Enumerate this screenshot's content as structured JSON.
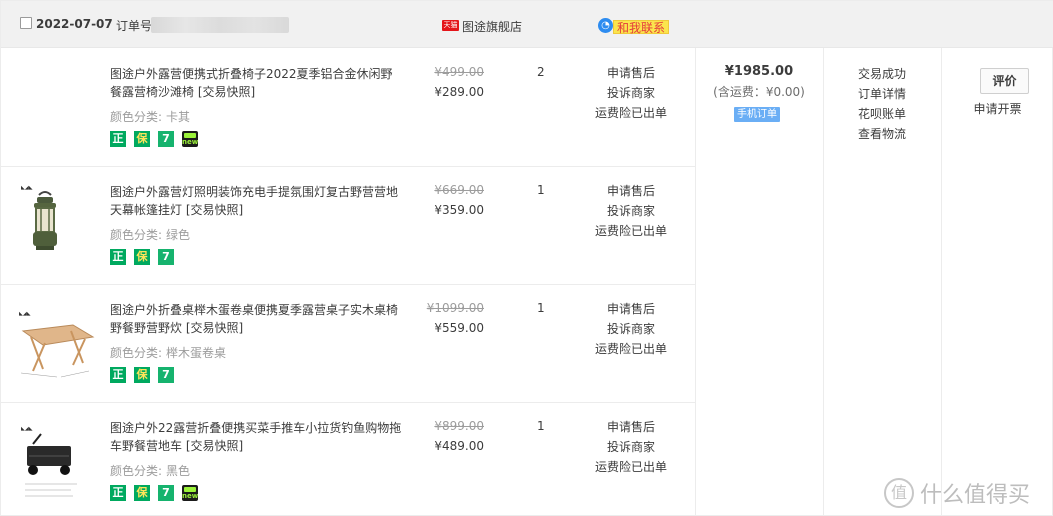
{
  "header": {
    "date": "2022-07-07",
    "order_no_label": "订单号",
    "shop_badge": "天猫",
    "shop_name": "图途旗舰店",
    "contact_label": "和我联系"
  },
  "items": [
    {
      "title": "图途户外露营便携式折叠椅子2022夏季铝合金休闲野餐露营椅沙滩椅 [交易快照]",
      "attr_label": "颜色分类:",
      "attr_value": "卡其",
      "orig_price": "¥499.00",
      "price": "¥289.00",
      "qty": "2",
      "ops": [
        "申请售后",
        "投诉商家",
        "运费险已出单"
      ],
      "icons": [
        "正",
        "保",
        "7",
        "new"
      ],
      "image": "none"
    },
    {
      "title": "图途户外露营灯照明装饰充电手提氛围灯复古野营营地天幕帐篷挂灯 [交易快照]",
      "attr_label": "颜色分类:",
      "attr_value": "绿色",
      "orig_price": "¥669.00",
      "price": "¥359.00",
      "qty": "1",
      "ops": [
        "申请售后",
        "投诉商家",
        "运费险已出单"
      ],
      "icons": [
        "正",
        "保",
        "7"
      ],
      "image": "lantern"
    },
    {
      "title": "图途户外折叠桌榉木蛋卷桌便携夏季露营桌子实木桌椅野餐野营野炊 [交易快照]",
      "attr_label": "颜色分类:",
      "attr_value": "榉木蛋卷桌",
      "orig_price": "¥1099.00",
      "price": "¥559.00",
      "qty": "1",
      "ops": [
        "申请售后",
        "投诉商家",
        "运费险已出单"
      ],
      "icons": [
        "正",
        "保",
        "7"
      ],
      "image": "table"
    },
    {
      "title": "图途户外22露营折叠便携买菜手推车小拉货钓鱼购物拖车野餐营地车 [交易快照]",
      "attr_label": "颜色分类:",
      "attr_value": "黑色",
      "orig_price": "¥899.00",
      "price": "¥489.00",
      "qty": "1",
      "ops": [
        "申请售后",
        "投诉商家",
        "运费险已出单"
      ],
      "icons": [
        "正",
        "保",
        "7",
        "new"
      ],
      "image": "cart"
    }
  ],
  "summary": {
    "total": "¥1985.00",
    "shipping": "(含运费：¥0.00)",
    "mobile_tag": "手机订单"
  },
  "status": [
    "交易成功",
    "订单详情",
    "花呗账单",
    "查看物流"
  ],
  "actions": {
    "rate": "评价",
    "invoice": "申请开票"
  },
  "watermark": {
    "logo": "值",
    "text": "什么值得买"
  },
  "colors": {
    "header_bg": "#f1f1f1",
    "tmall_red": "#e4151a",
    "contact_yellow": "#fbe54d",
    "icon_green": "#00a95f",
    "mobile_blue": "#6aaef5"
  }
}
